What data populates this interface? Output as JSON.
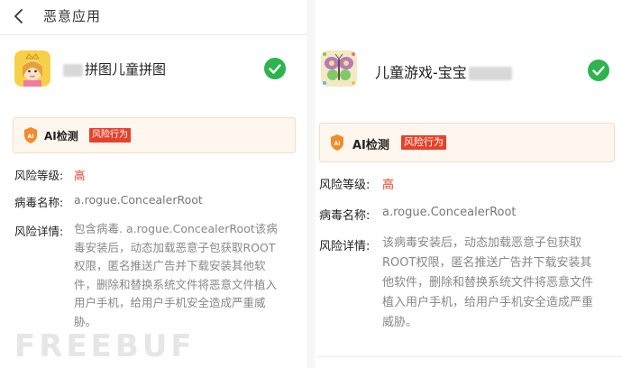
{
  "header": {
    "title": "恶意应用"
  },
  "left_app": {
    "name": "拼图儿童拼图",
    "ai_label": "AI检测",
    "risk_tag": "风险行为",
    "risk_level_label": "风险等级:",
    "risk_level_value": "高",
    "virus_label": "病毒名称:",
    "virus_value": "a.rogue.ConcealerRoot",
    "detail_label": "风险详情:",
    "detail_lines": [
      "包含病毒. a.rogue.ConcealerRoot该病",
      "毒安装后，动态加载恶意子包获取ROOT",
      "权限，匿名推送广告并下载安装其他软",
      "件，删除和替换系统文件将恶意文件植入",
      "用户手机，给用户手机安全造成严重威",
      "胁。"
    ]
  },
  "right_app": {
    "name": "儿童游戏-宝宝",
    "ai_label": "AI检测",
    "risk_tag": "风险行为",
    "risk_level_label": "风险等级:",
    "risk_level_value": "高",
    "virus_label": "病毒名称:",
    "virus_value": "a.rogue.ConcealerRoot",
    "detail_label": "风险详情:",
    "detail_lines": [
      "该病毒安装后，动态加载恶意子包获取",
      "ROOT权限，匿名推送广告并下载安装其",
      "他软件，删除和替换系统文件将恶意文件",
      "植入用户手机，给用户手机安全造成严重",
      "威胁。"
    ]
  },
  "watermark": "FREEBUF",
  "colors": {
    "risk_red": "#e8412a",
    "check_green": "#2fb34e",
    "ai_orange": "#f28b2c"
  }
}
